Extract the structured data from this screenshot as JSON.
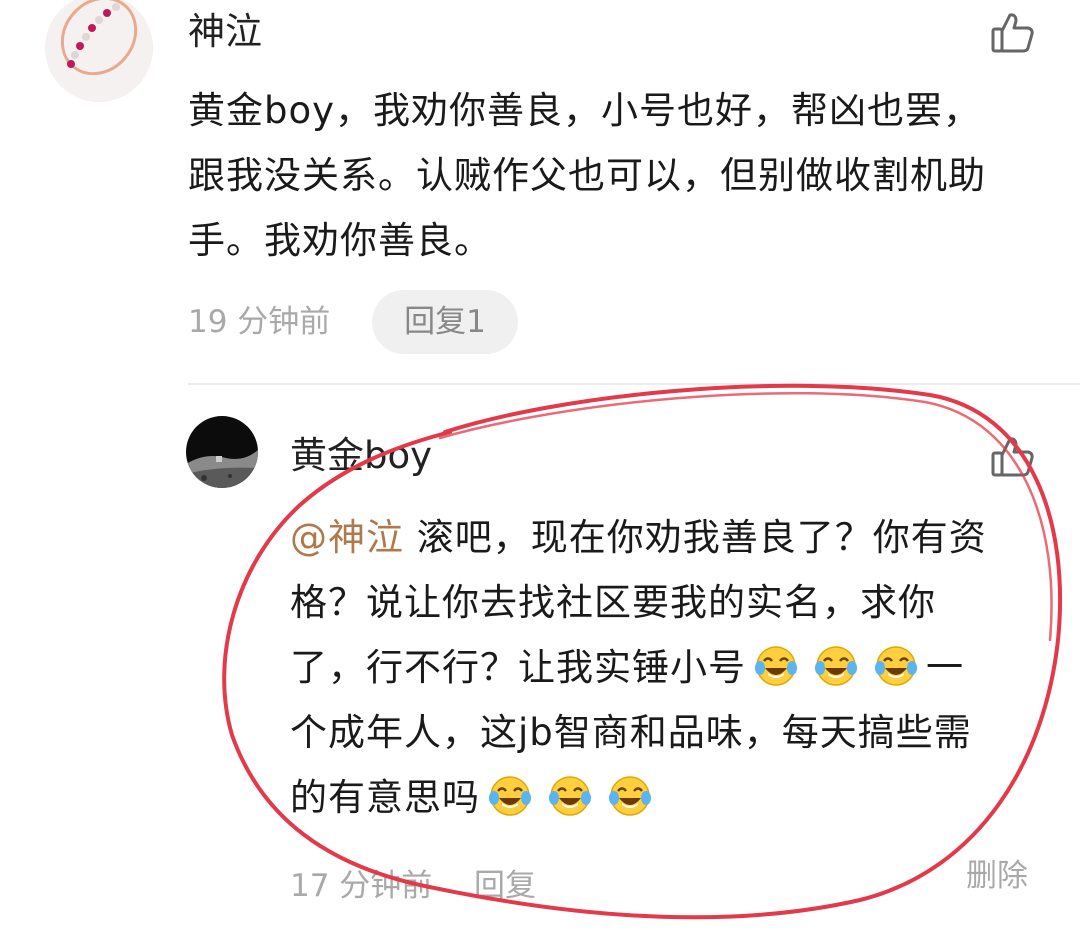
{
  "comment": {
    "author": "神泣",
    "lines": [
      "黄金boy，我劝你善良，小号也好，帮凶也罢，",
      "跟我没关系。认贼作父也可以，但别做收割机助",
      "手。我劝你善良。"
    ],
    "time": "19 分钟前",
    "reply_label": "回复1"
  },
  "reply": {
    "author": "黄金boy",
    "mention": "@神泣",
    "lines": [
      " 滚吧，现在你劝我善良了？你有资",
      "格？说让你去找社区要我的实名，求你",
      "了，行不行？让我实锤小号",
      "一",
      "个成年人，这jb智商和品味，每天搞些需",
      "的有意思吗"
    ],
    "time": "17 分钟前",
    "reply_label": "回复",
    "delete_label": "删除"
  },
  "icons": {
    "like": "thumbs-up-icon",
    "emoji": "tears-of-joy-emoji"
  },
  "colors": {
    "mention": "#b0794a",
    "annotation_circle": "#e23a4a",
    "meta_text": "#a9a9a9"
  }
}
